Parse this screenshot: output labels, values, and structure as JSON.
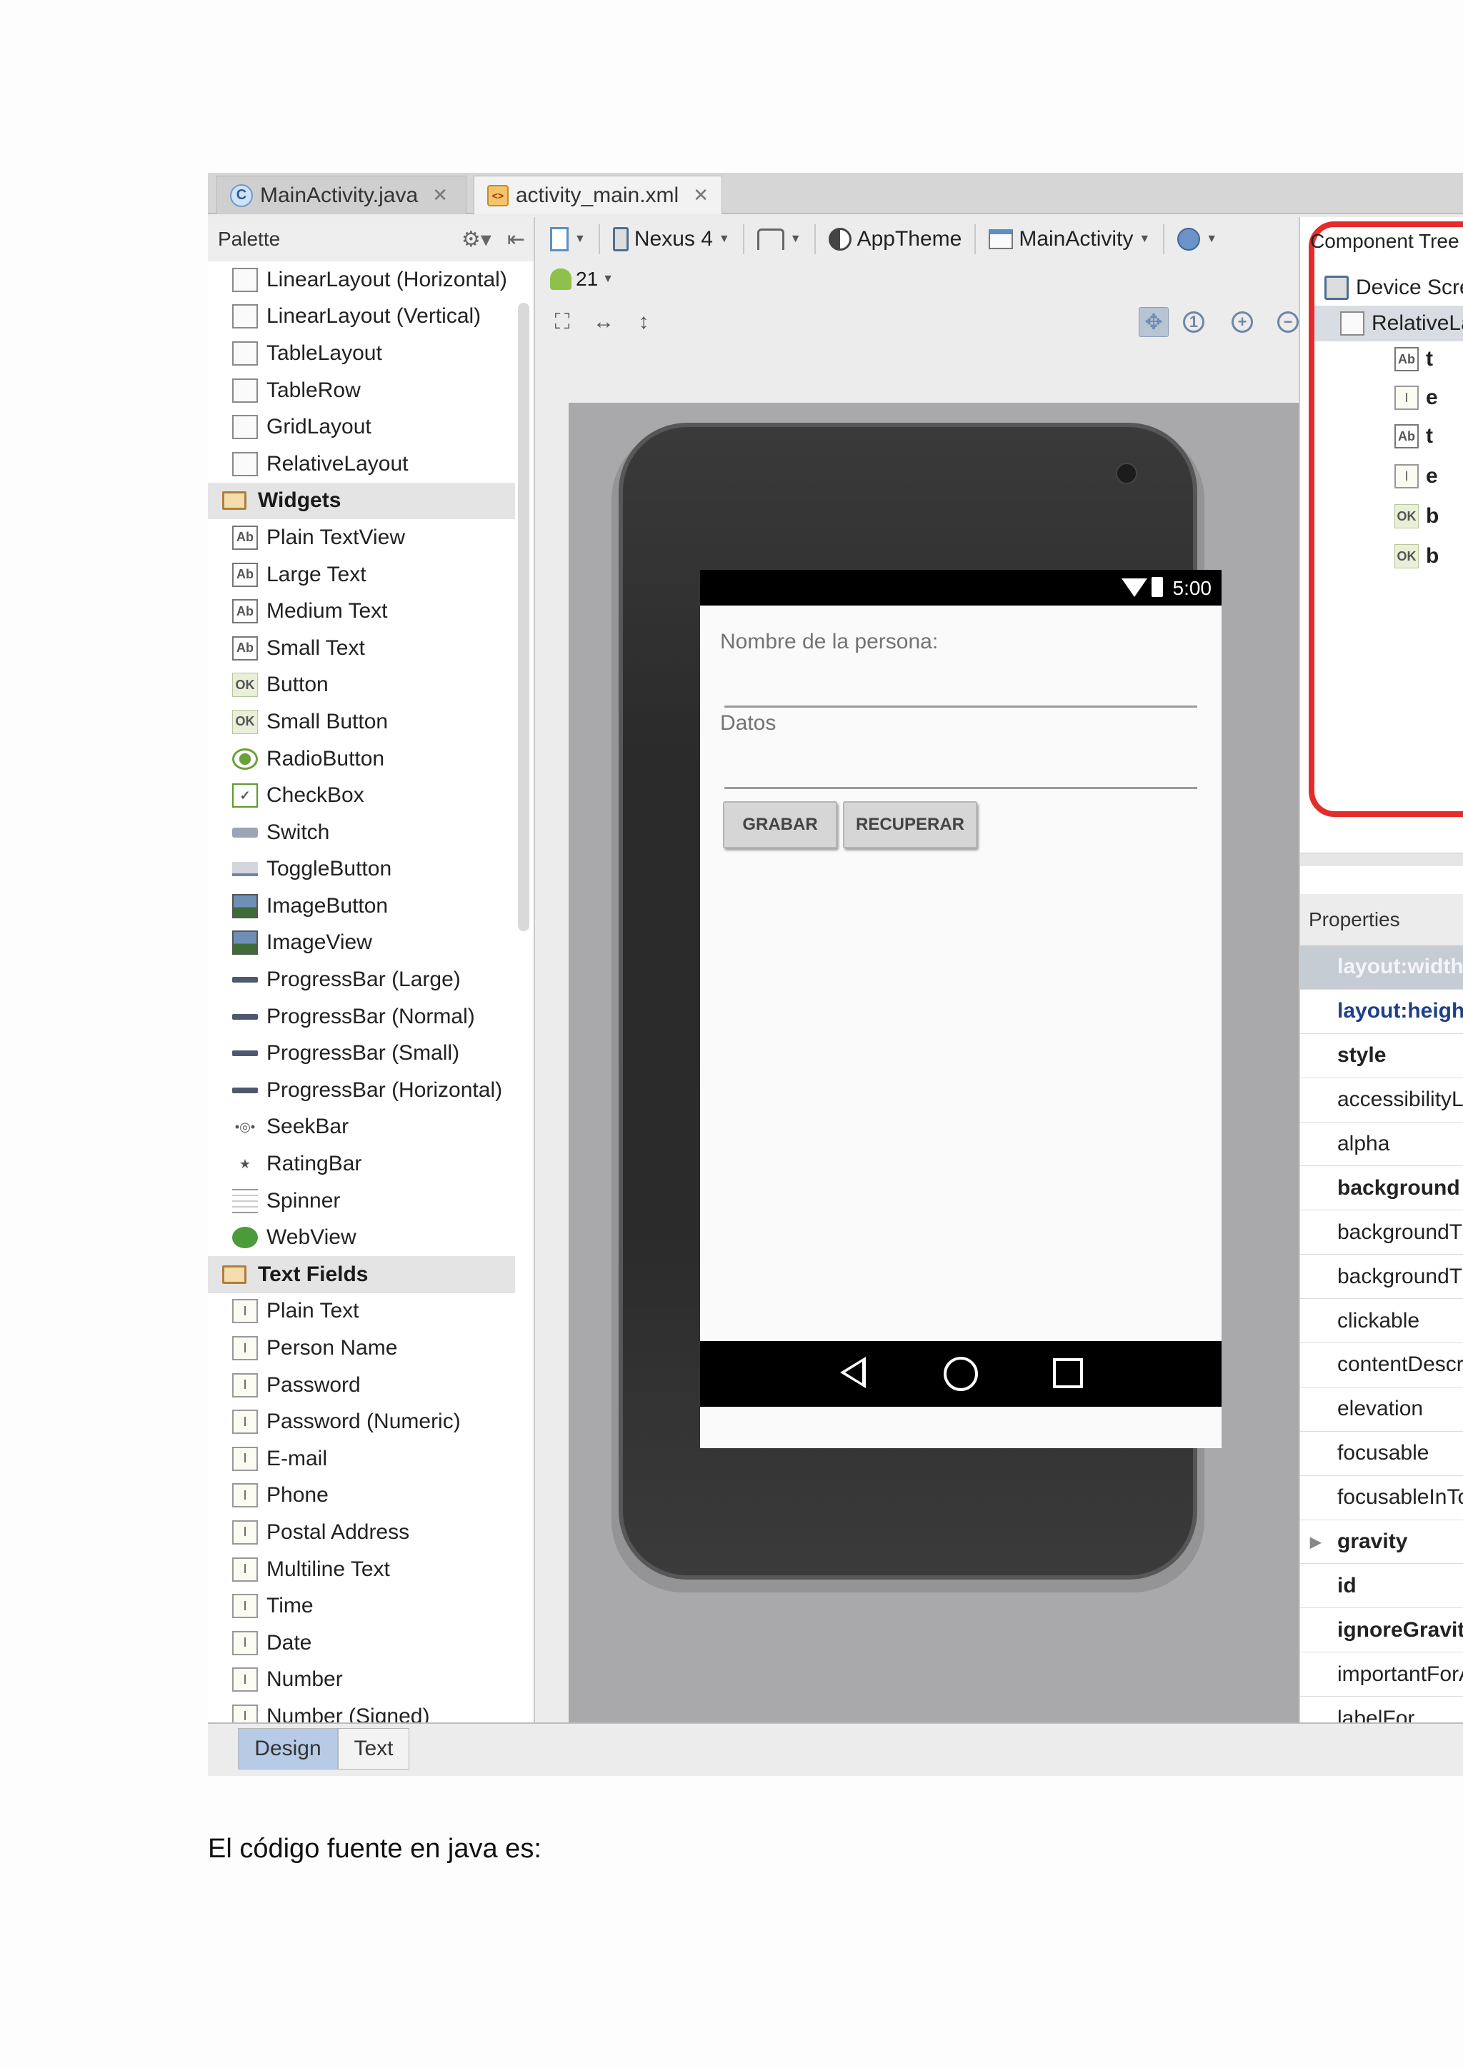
{
  "editor_tabs": [
    {
      "label": "MainActivity.java",
      "icon": "java-class-icon",
      "active": false
    },
    {
      "label": "activity_main.xml",
      "icon": "xml-file-icon",
      "active": true
    }
  ],
  "palette": {
    "title": "Palette",
    "items": [
      {
        "type": "item",
        "label": "LinearLayout (Horizontal)",
        "icon": "layout-icon"
      },
      {
        "type": "item",
        "label": "LinearLayout (Vertical)",
        "icon": "layout-icon"
      },
      {
        "type": "item",
        "label": "TableLayout",
        "icon": "layout-icon"
      },
      {
        "type": "item",
        "label": "TableRow",
        "icon": "layout-icon"
      },
      {
        "type": "item",
        "label": "GridLayout",
        "icon": "layout-icon"
      },
      {
        "type": "item",
        "label": "RelativeLayout",
        "icon": "layout-icon"
      },
      {
        "type": "category",
        "label": "Widgets"
      },
      {
        "type": "item",
        "label": "Plain TextView",
        "icon": "textview-icon"
      },
      {
        "type": "item",
        "label": "Large Text",
        "icon": "textview-icon"
      },
      {
        "type": "item",
        "label": "Medium Text",
        "icon": "textview-icon"
      },
      {
        "type": "item",
        "label": "Small Text",
        "icon": "textview-icon"
      },
      {
        "type": "item",
        "label": "Button",
        "icon": "button-icon"
      },
      {
        "type": "item",
        "label": "Small Button",
        "icon": "button-icon"
      },
      {
        "type": "item",
        "label": "RadioButton",
        "icon": "radio-icon"
      },
      {
        "type": "item",
        "label": "CheckBox",
        "icon": "checkbox-icon"
      },
      {
        "type": "item",
        "label": "Switch",
        "icon": "switch-icon"
      },
      {
        "type": "item",
        "label": "ToggleButton",
        "icon": "toggle-icon"
      },
      {
        "type": "item",
        "label": "ImageButton",
        "icon": "image-icon"
      },
      {
        "type": "item",
        "label": "ImageView",
        "icon": "image-icon"
      },
      {
        "type": "item",
        "label": "ProgressBar (Large)",
        "icon": "progressbar-icon"
      },
      {
        "type": "item",
        "label": "ProgressBar (Normal)",
        "icon": "progressbar-icon"
      },
      {
        "type": "item",
        "label": "ProgressBar (Small)",
        "icon": "progressbar-icon"
      },
      {
        "type": "item",
        "label": "ProgressBar (Horizontal)",
        "icon": "progressbar-icon"
      },
      {
        "type": "item",
        "label": "SeekBar",
        "icon": "seekbar-icon"
      },
      {
        "type": "item",
        "label": "RatingBar",
        "icon": "ratingbar-icon"
      },
      {
        "type": "item",
        "label": "Spinner",
        "icon": "spinner-icon"
      },
      {
        "type": "item",
        "label": "WebView",
        "icon": "webview-icon"
      },
      {
        "type": "category",
        "label": "Text Fields"
      },
      {
        "type": "item",
        "label": "Plain Text",
        "icon": "textfield-icon"
      },
      {
        "type": "item",
        "label": "Person Name",
        "icon": "textfield-icon"
      },
      {
        "type": "item",
        "label": "Password",
        "icon": "textfield-icon"
      },
      {
        "type": "item",
        "label": "Password (Numeric)",
        "icon": "textfield-icon"
      },
      {
        "type": "item",
        "label": "E-mail",
        "icon": "textfield-icon"
      },
      {
        "type": "item",
        "label": "Phone",
        "icon": "textfield-icon"
      },
      {
        "type": "item",
        "label": "Postal Address",
        "icon": "textfield-icon"
      },
      {
        "type": "item",
        "label": "Multiline Text",
        "icon": "textfield-icon"
      },
      {
        "type": "item",
        "label": "Time",
        "icon": "textfield-icon"
      },
      {
        "type": "item",
        "label": "Date",
        "icon": "textfield-icon"
      },
      {
        "type": "item",
        "label": "Number",
        "icon": "textfield-icon"
      },
      {
        "type": "item",
        "label": "Number (Signed)",
        "icon": "textfield-icon"
      }
    ]
  },
  "toolbar": {
    "device": "Nexus 4",
    "theme": "AppTheme",
    "activity": "MainActivity",
    "api_level": "21"
  },
  "phone_preview": {
    "status_time": "5:00",
    "field1_label": "Nombre de la persona:",
    "field2_label": "Datos",
    "button1": "GRABAR",
    "button2": "RECUPERAR"
  },
  "component_tree": {
    "title": "Component Tree",
    "rows": [
      {
        "label": "Device Screen",
        "icon": "device-icon"
      },
      {
        "label": "RelativeLayout",
        "icon": "layout-icon"
      },
      {
        "label": "t",
        "icon": "textview-icon"
      },
      {
        "label": "e",
        "icon": "textfield-icon"
      },
      {
        "label": "t",
        "icon": "textview-icon"
      },
      {
        "label": "e",
        "icon": "textfield-icon"
      },
      {
        "label": "b",
        "icon": "button-icon"
      },
      {
        "label": "b",
        "icon": "button-icon"
      }
    ]
  },
  "properties": {
    "title": "Properties",
    "rows": [
      {
        "name": "layout:width",
        "style": "selected"
      },
      {
        "name": "layout:height",
        "style": "blue"
      },
      {
        "name": "style",
        "style": "bold"
      },
      {
        "name": "accessibilityLiveRegion",
        "style": "normal"
      },
      {
        "name": "alpha",
        "style": "normal"
      },
      {
        "name": "background",
        "style": "bold"
      },
      {
        "name": "backgroundTint",
        "style": "normal"
      },
      {
        "name": "backgroundTintMode",
        "style": "normal"
      },
      {
        "name": "clickable",
        "style": "normal"
      },
      {
        "name": "contentDescription",
        "style": "normal"
      },
      {
        "name": "elevation",
        "style": "normal"
      },
      {
        "name": "focusable",
        "style": "normal"
      },
      {
        "name": "focusableInTouchMode",
        "style": "normal"
      },
      {
        "name": "gravity",
        "style": "bold",
        "expandable": true
      },
      {
        "name": "id",
        "style": "bold"
      },
      {
        "name": "ignoreGravity",
        "style": "bold"
      },
      {
        "name": "importantForAccessibility",
        "style": "normal"
      },
      {
        "name": "labelFor",
        "style": "normal"
      }
    ]
  },
  "bottom_tabs": [
    "Design",
    "Text"
  ],
  "caption": "El código fuente en java es:",
  "colors": {
    "highlight_frame": "#e52b2b",
    "selected_tab": "#b7cbe6"
  }
}
